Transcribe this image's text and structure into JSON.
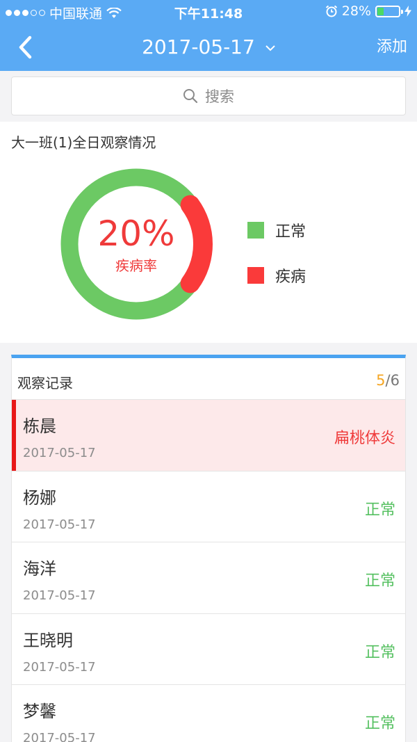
{
  "status_bar": {
    "carrier": "中国联通",
    "time": "下午11:48",
    "battery": "28%",
    "battery_level": 0.28
  },
  "nav": {
    "title": "2017-05-17",
    "add_label": "添加",
    "icons": [
      "back-chevron-icon",
      "dropdown-chevron-icon"
    ]
  },
  "search": {
    "placeholder": "搜索"
  },
  "summary": {
    "title": "大一班(1)全日观察情况",
    "percent": "20%",
    "percent_label": "疾病率",
    "legend": [
      {
        "label": "正常",
        "color": "#6cc964"
      },
      {
        "label": "疾病",
        "color": "#fa3a3a"
      }
    ],
    "chart_data": {
      "type": "pie",
      "slices": [
        {
          "label": "正常",
          "value": 80,
          "color": "#6cc964"
        },
        {
          "label": "疾病",
          "value": 20,
          "color": "#fa3a3a"
        }
      ]
    }
  },
  "records": {
    "title": "观察记录",
    "count_current": "5",
    "count_sep": "/",
    "count_total": "6",
    "items": [
      {
        "name": "栋晨",
        "date": "2017-05-17",
        "status": "扁桃体炎",
        "type": "sick"
      },
      {
        "name": "杨娜",
        "date": "2017-05-17",
        "status": "正常",
        "type": "normal"
      },
      {
        "name": "海洋",
        "date": "2017-05-17",
        "status": "正常",
        "type": "normal"
      },
      {
        "name": "王晓明",
        "date": "2017-05-17",
        "status": "正常",
        "type": "normal"
      },
      {
        "name": "梦馨",
        "date": "2017-05-17",
        "status": "正常",
        "type": "normal"
      }
    ]
  },
  "colors": {
    "accent": "#5aaaf4",
    "normal": "#6cc964",
    "sick": "#fa3a3a",
    "pending": "#f5a623"
  }
}
